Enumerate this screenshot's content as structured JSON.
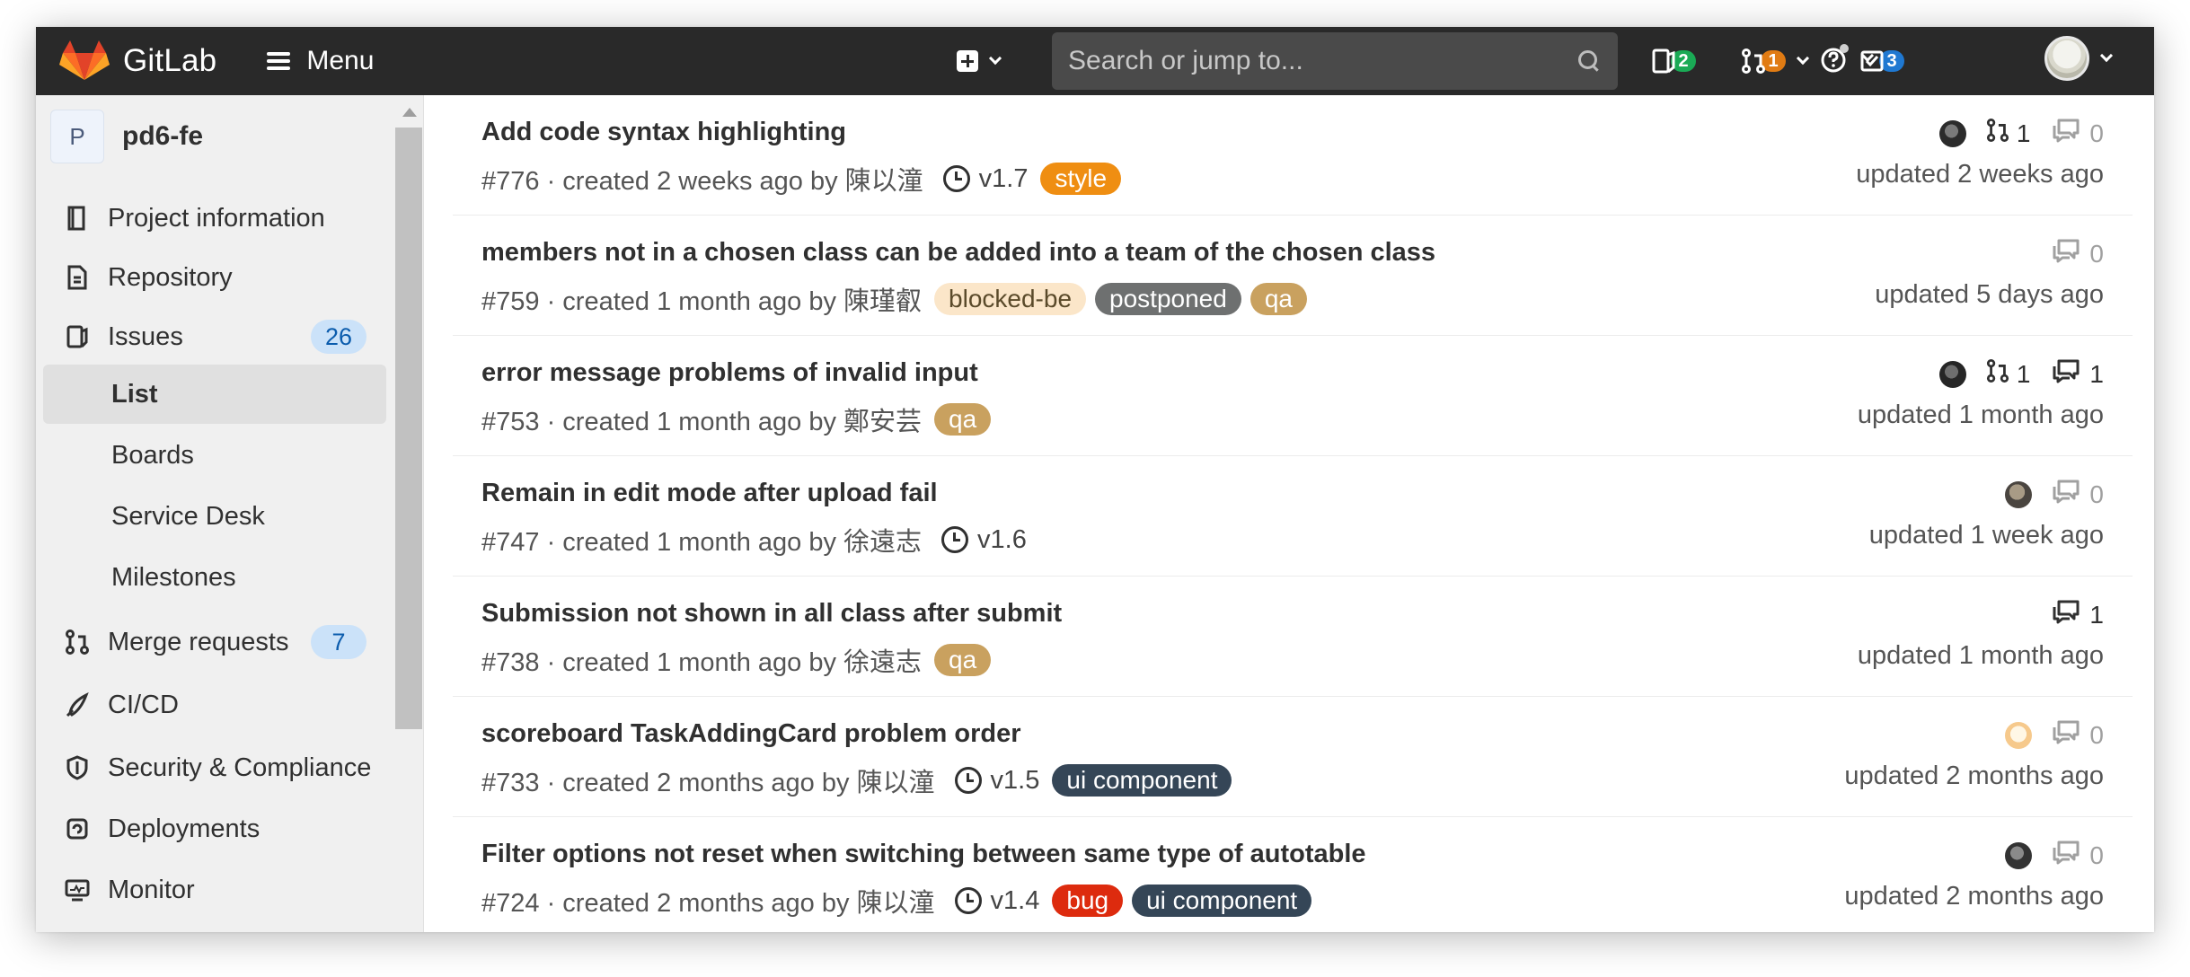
{
  "navbar": {
    "brand": "GitLab",
    "menu_label": "Menu",
    "search_placeholder": "Search or jump to...",
    "counters": {
      "issues": {
        "count": "2",
        "color": "#1aaa55"
      },
      "merge_requests": {
        "count": "1",
        "color": "#e07b13"
      },
      "todos": {
        "count": "3",
        "color": "#1f78d1"
      }
    }
  },
  "sidebar": {
    "project_avatar": "P",
    "project_name": "pd6-fe",
    "items": {
      "project_information": "Project information",
      "repository": "Repository",
      "issues": "Issues",
      "issues_count": "26",
      "list": "List",
      "boards": "Boards",
      "service_desk": "Service Desk",
      "milestones": "Milestones",
      "merge_requests": "Merge requests",
      "merge_requests_count": "7",
      "cicd": "CI/CD",
      "security": "Security & Compliance",
      "deployments": "Deployments",
      "monitor": "Monitor"
    }
  },
  "colors": {
    "style": "#ef8e12",
    "blocked_be": "#fbe6c9",
    "postponed": "#6e7070",
    "qa": "#c9a15f",
    "ui_component": "#354657",
    "bug": "#dd2b0e"
  },
  "issues": [
    {
      "title": "Add code syntax highlighting",
      "meta": "#776 · created 2 weeks ago by 陳以潼",
      "milestone": "v1.7",
      "labels": [
        {
          "text": "style",
          "bg": "#ef8e12",
          "fg": "#ffffff"
        }
      ],
      "mr_count": "1",
      "comments": "0",
      "updated": "updated 2 weeks ago"
    },
    {
      "title": "members not in a chosen class can be added into a team of the chosen class",
      "meta": "#759 · created 1 month ago by 陳瑾叡",
      "milestone": "",
      "labels": [
        {
          "text": "blocked-be",
          "bg": "#fbe6c9",
          "fg": "#5a4a2a"
        },
        {
          "text": "postponed",
          "bg": "#6e7070",
          "fg": "#ffffff"
        },
        {
          "text": "qa",
          "bg": "#c9a15f",
          "fg": "#ffffff"
        }
      ],
      "mr_count": "",
      "comments": "0",
      "updated": "updated 5 days ago"
    },
    {
      "title": "error message problems of invalid input",
      "meta": "#753 · created 1 month ago by 鄭安芸",
      "milestone": "",
      "labels": [
        {
          "text": "qa",
          "bg": "#c9a15f",
          "fg": "#ffffff"
        }
      ],
      "mr_count": "1",
      "comments": "1",
      "updated": "updated 1 month ago"
    },
    {
      "title": "Remain in edit mode after upload fail",
      "meta": "#747 · created 1 month ago by 徐遠志",
      "milestone": "v1.6",
      "labels": [],
      "mr_count": "",
      "comments": "0",
      "updated": "updated 1 week ago"
    },
    {
      "title": "Submission not shown in all class after submit",
      "meta": "#738 · created 1 month ago by 徐遠志",
      "milestone": "",
      "labels": [
        {
          "text": "qa",
          "bg": "#c9a15f",
          "fg": "#ffffff"
        }
      ],
      "mr_count": "",
      "comments": "1",
      "updated": "updated 1 month ago"
    },
    {
      "title": "scoreboard TaskAddingCard problem order",
      "meta": "#733 · created 2 months ago by 陳以潼",
      "milestone": "v1.5",
      "labels": [
        {
          "text": "ui component",
          "bg": "#354657",
          "fg": "#ffffff"
        }
      ],
      "mr_count": "",
      "comments": "0",
      "updated": "updated 2 months ago"
    },
    {
      "title": "Filter options not reset when switching between same type of autotable",
      "meta": "#724 · created 2 months ago by 陳以潼",
      "milestone": "v1.4",
      "labels": [
        {
          "text": "bug",
          "bg": "#dd2b0e",
          "fg": "#ffffff"
        },
        {
          "text": "ui component",
          "bg": "#354657",
          "fg": "#ffffff"
        }
      ],
      "mr_count": "",
      "comments": "0",
      "updated": "updated 2 months ago"
    }
  ]
}
